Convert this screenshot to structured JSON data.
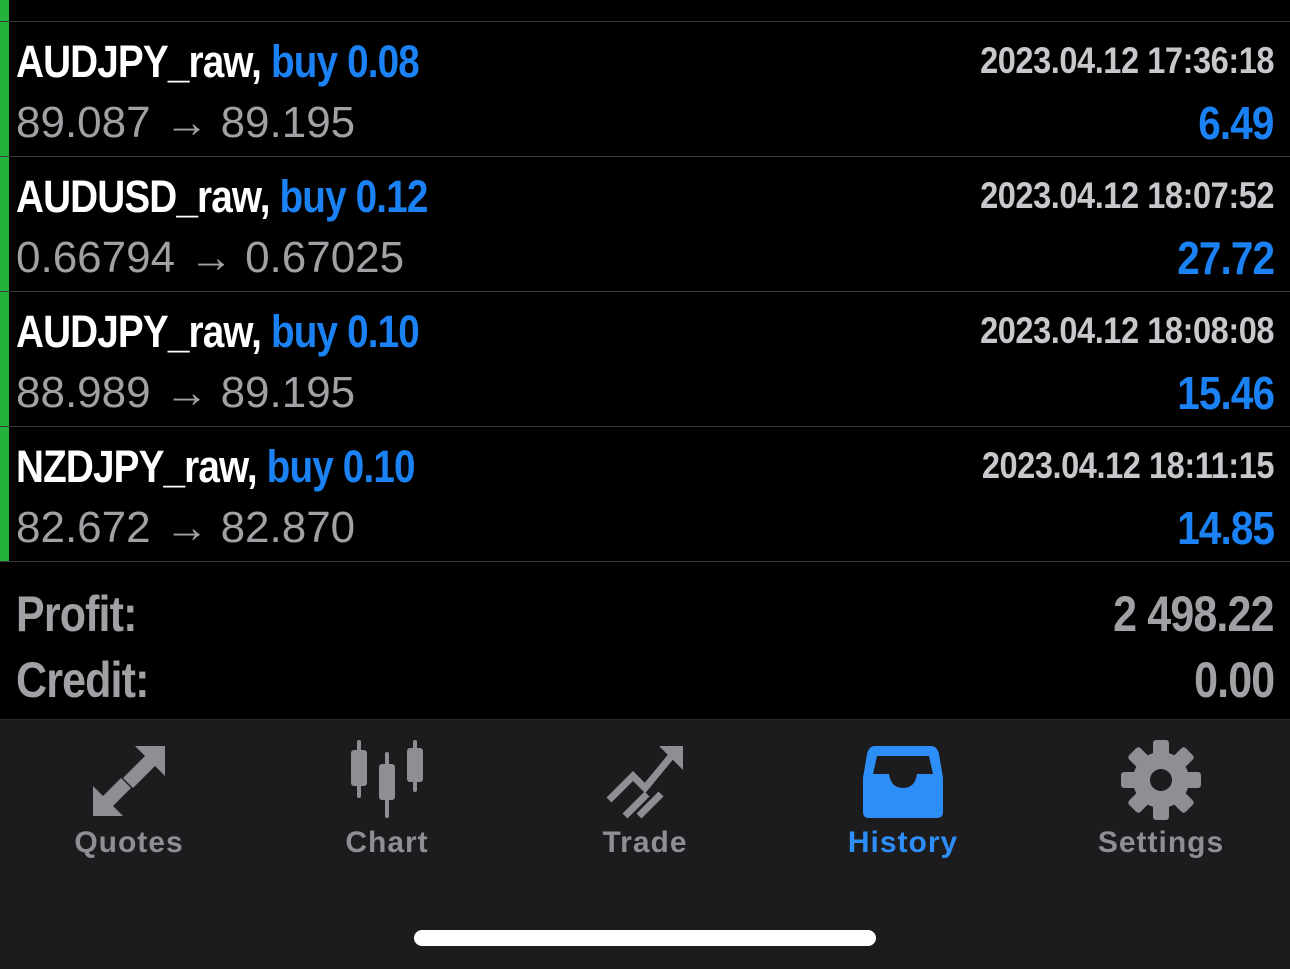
{
  "trades": [
    {
      "symbol": "",
      "side_volume": "",
      "time": "",
      "open_price": "",
      "arrow": "",
      "close_price": "",
      "profit": "",
      "partial": true
    },
    {
      "symbol": "AUDJPY_raw,",
      "side_volume": "buy 0.08",
      "time": "2023.04.12 17:36:18",
      "open_price": "89.087",
      "arrow": "→",
      "close_price": "89.195",
      "profit": "6.49"
    },
    {
      "symbol": "AUDUSD_raw,",
      "side_volume": "buy 0.12",
      "time": "2023.04.12 18:07:52",
      "open_price": "0.66794",
      "arrow": "→",
      "close_price": "0.67025",
      "profit": "27.72"
    },
    {
      "symbol": "AUDJPY_raw,",
      "side_volume": "buy 0.10",
      "time": "2023.04.12 18:08:08",
      "open_price": "88.989",
      "arrow": "→",
      "close_price": "89.195",
      "profit": "15.46"
    },
    {
      "symbol": "NZDJPY_raw,",
      "side_volume": "buy 0.10",
      "time": "2023.04.12 18:11:15",
      "open_price": "82.672",
      "arrow": "→",
      "close_price": "82.870",
      "profit": "14.85"
    }
  ],
  "summary": {
    "profit_label": "Profit:",
    "profit_value": "2 498.22",
    "credit_label": "Credit:",
    "credit_value": "0.00"
  },
  "tabs": [
    {
      "label": "Quotes",
      "icon": "quotes-arrows-icon",
      "active": false
    },
    {
      "label": "Chart",
      "icon": "candlestick-chart-icon",
      "active": false
    },
    {
      "label": "Trade",
      "icon": "trade-trend-icon",
      "active": false
    },
    {
      "label": "History",
      "icon": "inbox-tray-icon",
      "active": true
    },
    {
      "label": "Settings",
      "icon": "gear-icon",
      "active": false
    }
  ],
  "colors": {
    "background": "#000000",
    "accent_blue": "#1a82f4",
    "status_green": "#25b23b",
    "muted_gray": "#a0a0a5",
    "tab_bar": "#1c1c1e"
  }
}
